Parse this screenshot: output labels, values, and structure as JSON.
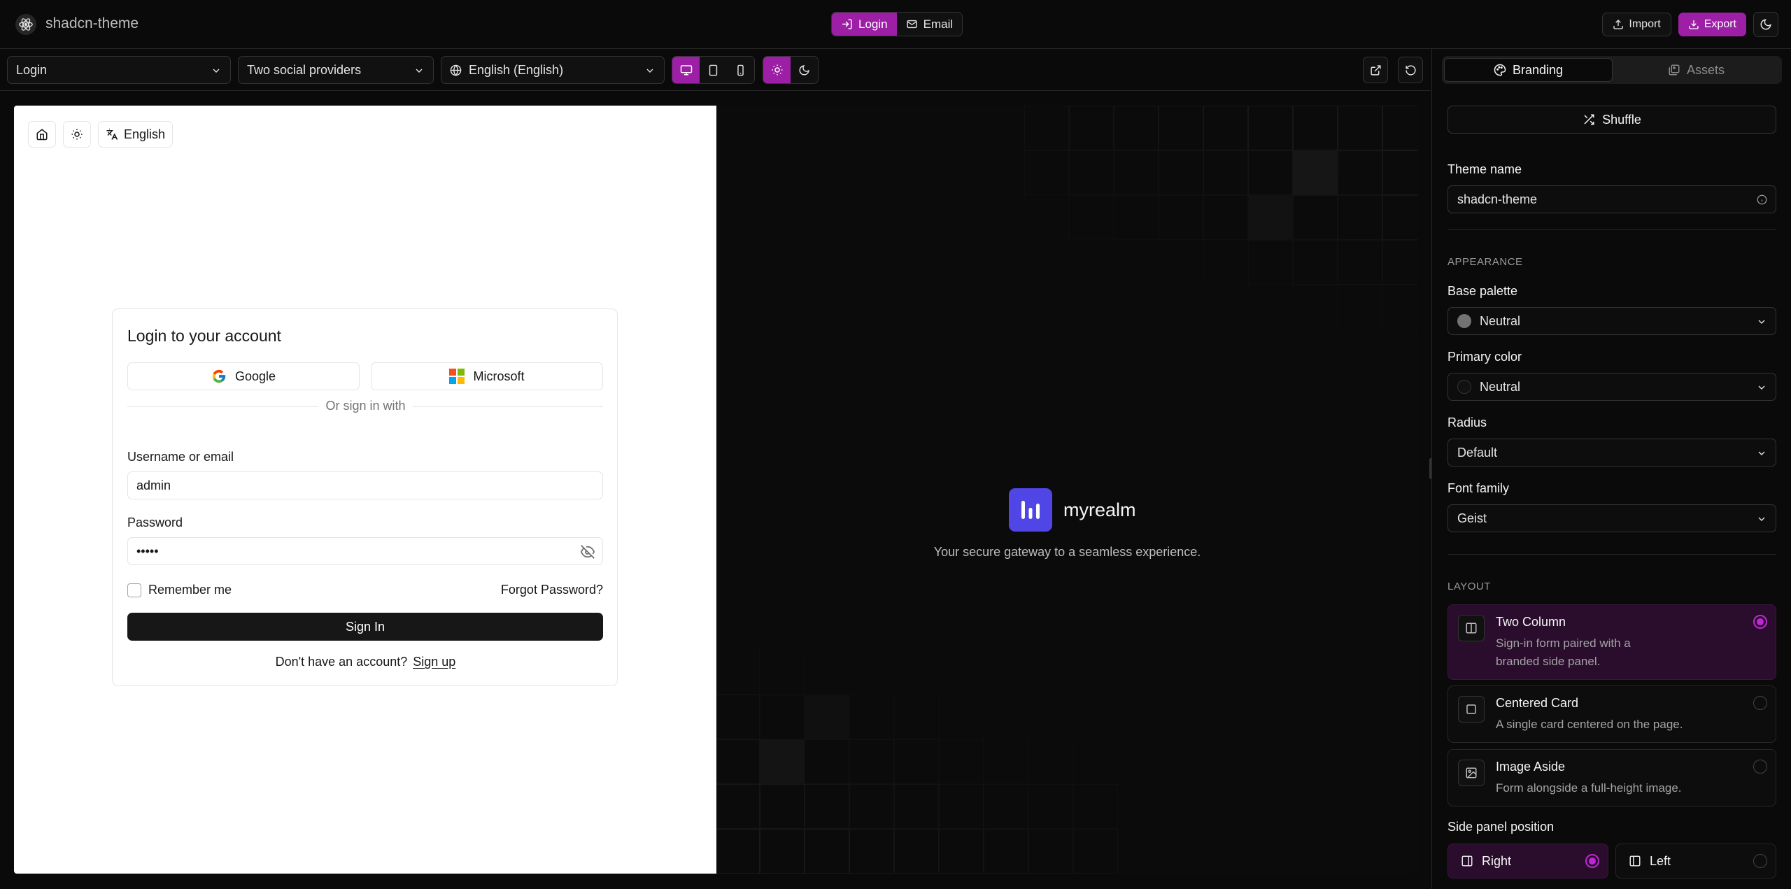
{
  "app": {
    "title": "shadcn-theme"
  },
  "mode_toggle": {
    "login": "Login",
    "email": "Email"
  },
  "header_actions": {
    "import": "Import",
    "export": "Export"
  },
  "toolbar": {
    "page_select": "Login",
    "variant_select": "Two social providers",
    "language_select": "English (English)"
  },
  "preview": {
    "language_chip": "English",
    "card": {
      "title": "Login to your account",
      "google": "Google",
      "microsoft": "Microsoft",
      "divider": "Or sign in with",
      "username_label": "Username or email",
      "username_value": "admin",
      "password_label": "Password",
      "password_value": "•••••",
      "remember": "Remember me",
      "forgot": "Forgot Password?",
      "signin": "Sign In",
      "no_account": "Don't have an account?",
      "signup": "Sign up"
    },
    "brand": {
      "name": "myrealm",
      "tagline": "Your secure gateway to a seamless experience.",
      "logo_color": "#4f46e5"
    }
  },
  "panel": {
    "tabs": {
      "branding": "Branding",
      "assets": "Assets"
    },
    "shuffle": "Shuffle",
    "theme_name_label": "Theme name",
    "theme_name_value": "shadcn-theme",
    "appearance_heading": "APPEARANCE",
    "base_palette_label": "Base palette",
    "base_palette_value": "Neutral",
    "primary_color_label": "Primary color",
    "primary_color_value": "Neutral",
    "radius_label": "Radius",
    "radius_value": "Default",
    "font_family_label": "Font family",
    "font_family_value": "Geist",
    "layout_heading": "LAYOUT",
    "layouts": [
      {
        "title": "Two Column",
        "desc": "Sign-in form paired with a branded side panel."
      },
      {
        "title": "Centered Card",
        "desc": "A single card centered on the page."
      },
      {
        "title": "Image Aside",
        "desc": "Form alongside a full-height image."
      }
    ],
    "side_panel_label": "Side panel position",
    "side_right": "Right",
    "side_left": "Left"
  },
  "colors": {
    "accent": "#9c1fa6",
    "background": "#0a0a0a"
  }
}
